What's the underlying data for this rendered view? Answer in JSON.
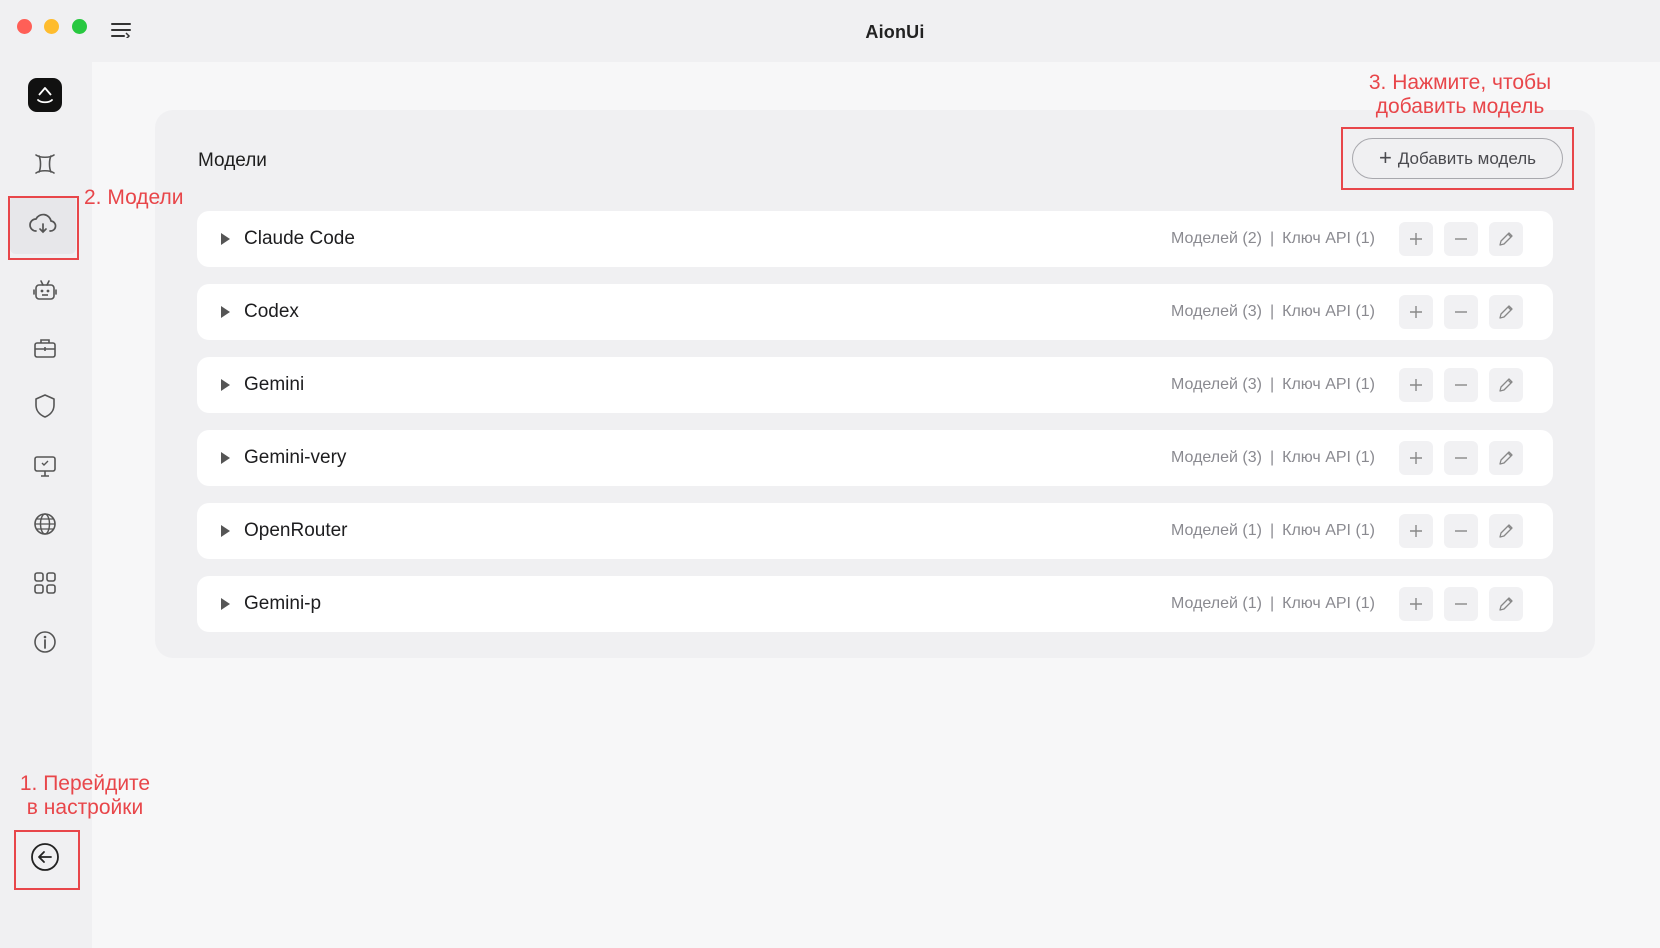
{
  "window": {
    "title": "AionUi"
  },
  "sidebar": {
    "items": [
      {
        "icon": "model-icon"
      },
      {
        "icon": "cloud-icon"
      },
      {
        "icon": "robot-icon"
      },
      {
        "icon": "toolbox-icon"
      },
      {
        "icon": "shield-icon"
      },
      {
        "icon": "monitor-icon"
      },
      {
        "icon": "globe-icon"
      },
      {
        "icon": "apps-grid-icon"
      },
      {
        "icon": "info-icon"
      }
    ],
    "active": "cloud-icon",
    "back_icon": "back-arrow-icon"
  },
  "main": {
    "title": "Модели",
    "add_button_label": "Добавить модель",
    "providers": [
      {
        "name": "Claude Code",
        "models": "Моделей (2)",
        "keys": "Ключ API (1)"
      },
      {
        "name": "Codex",
        "models": "Моделей (3)",
        "keys": "Ключ API (1)"
      },
      {
        "name": "Gemini",
        "models": "Моделей (3)",
        "keys": "Ключ API (1)"
      },
      {
        "name": "Gemini-very",
        "models": "Моделей (3)",
        "keys": "Ключ API (1)"
      },
      {
        "name": "OpenRouter",
        "models": "Моделей (1)",
        "keys": "Ключ API (1)"
      },
      {
        "name": "Gemini-p",
        "models": "Моделей (1)",
        "keys": "Ключ API (1)"
      }
    ],
    "separator": "|"
  },
  "annotations": {
    "step1": "1. Перейдите в настройки",
    "step1_line1": "1. Перейдите",
    "step1_line2": "в настройки",
    "step2": "2. Модели",
    "step3_line1": "3. Нажмите, чтобы",
    "step3_line2": "добавить модель"
  },
  "colors": {
    "annotation": "#e8464a",
    "background": "#f7f7f8",
    "panel": "#f0f0f2"
  }
}
